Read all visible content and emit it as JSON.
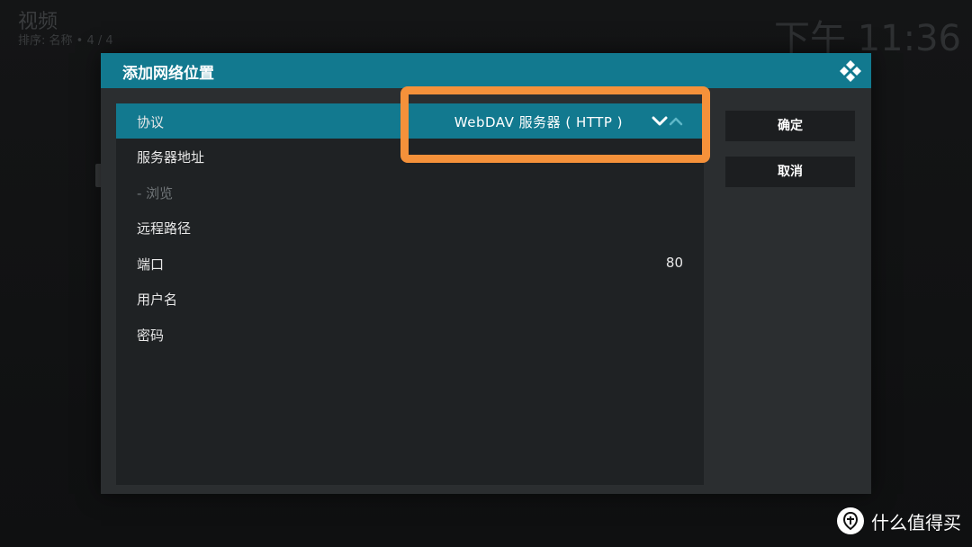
{
  "background": {
    "title": "视频",
    "sort_text": "排序: 名称  •  4 / 4",
    "clock": "下午 11:36"
  },
  "dialog": {
    "title": "添加网络位置",
    "settings": [
      {
        "label": "协议",
        "value": "WebDAV 服务器 ( HTTP )",
        "focused": true,
        "disabled": false
      },
      {
        "label": "服务器地址",
        "value": "",
        "focused": false,
        "disabled": false
      },
      {
        "label": "- 浏览",
        "value": "",
        "focused": false,
        "disabled": true
      },
      {
        "label": "远程路径",
        "value": "",
        "focused": false,
        "disabled": false
      },
      {
        "label": "端口",
        "value": "80",
        "focused": false,
        "disabled": false
      },
      {
        "label": "用户名",
        "value": "",
        "focused": false,
        "disabled": false
      },
      {
        "label": "密码",
        "value": "",
        "focused": false,
        "disabled": false
      }
    ],
    "buttons": {
      "ok_label": "确定",
      "cancel_label": "取消"
    }
  },
  "watermark": {
    "text": "什么值得买"
  },
  "colors": {
    "header": "#12798f",
    "focus_row": "#12798f",
    "highlight": "#f5913a",
    "dialog_bg": "#2b2e30",
    "panel_bg": "#1f2224"
  },
  "icons": {
    "header_logo": "kodi-logo-icon",
    "spinner_down": "chevron-down-icon",
    "spinner_up": "chevron-up-icon",
    "watermark_logo": "smzdm-logo-icon"
  }
}
